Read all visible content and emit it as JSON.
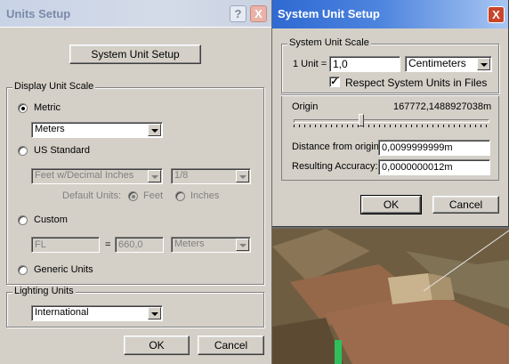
{
  "units_setup": {
    "title": "Units Setup",
    "help_label": "?",
    "close_label": "X",
    "system_unit_setup_button": "System Unit Setup",
    "display_unit_scale": {
      "legend": "Display Unit Scale",
      "metric_label": "Metric",
      "metric_value": "Meters",
      "us_standard_label": "US Standard",
      "us_unit_value": "Feet w/Decimal Inches",
      "us_fraction_value": "1/8",
      "default_units_label": "Default Units:",
      "feet_label": "Feet",
      "inches_label": "Inches",
      "custom_label": "Custom",
      "custom_name": "FL",
      "equals_sign": "=",
      "custom_value": "660,0",
      "custom_unit": "Meters",
      "generic_label": "Generic Units",
      "selected": "Metric"
    },
    "lighting_units": {
      "legend": "Lighting Units",
      "value": "International"
    },
    "ok_label": "OK",
    "cancel_label": "Cancel"
  },
  "system_unit_setup": {
    "title": "System Unit Setup",
    "close_label": "X",
    "group_legend": "System Unit Scale",
    "one_unit_label": "1 Unit =",
    "unit_value": "1,0",
    "unit_type": "Centimeters",
    "respect_label": "Respect System Units in Files",
    "respect_checked": true,
    "origin_label": "Origin",
    "origin_value": "167772,1488927038m",
    "slider_position": 0.34,
    "distance_label": "Distance from origin:",
    "distance_value": "0,0099999999m",
    "accuracy_label": "Resulting Accuracy:",
    "accuracy_value": "0,0000000012m",
    "ok_label": "OK",
    "cancel_label": "Cancel"
  },
  "colors": {
    "dialog_face": "#d4d0c8",
    "title_left": "#2f69d2",
    "title_right": "#a8c6f2",
    "close_red": "#c9452a"
  }
}
